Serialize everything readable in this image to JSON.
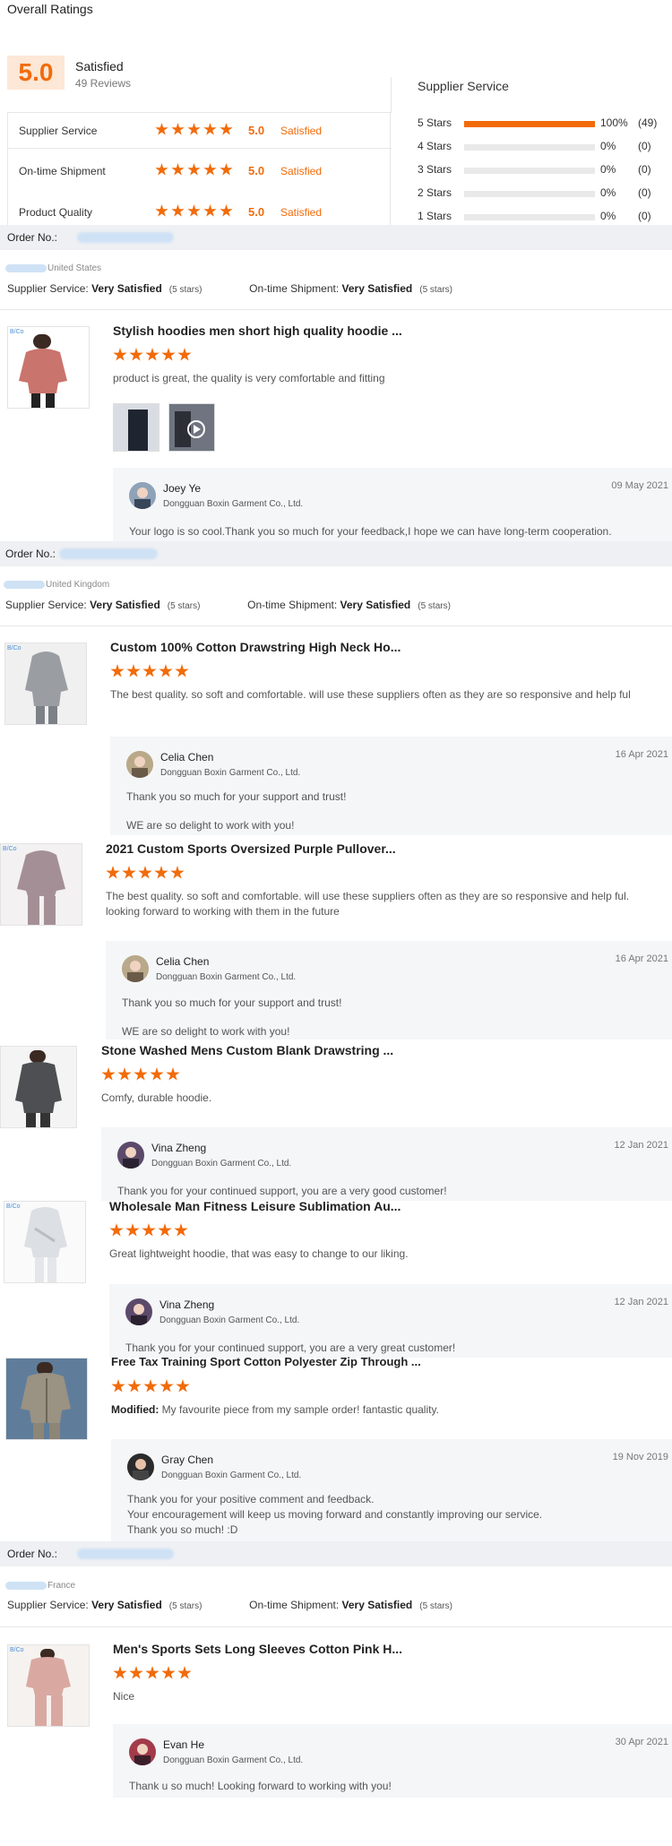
{
  "header": {
    "title": "Overall Ratings"
  },
  "overall": {
    "score": "5.0",
    "label": "Satisfied",
    "reviews": "49 Reviews"
  },
  "summary": [
    {
      "label": "Supplier Service",
      "score": "5.0",
      "word": "Satisfied"
    },
    {
      "label": "On-time Shipment",
      "score": "5.0",
      "word": "Satisfied"
    },
    {
      "label": "Product Quality",
      "score": "5.0",
      "word": "Satisfied"
    }
  ],
  "supplier_service": {
    "title": "Supplier Service",
    "rows": [
      {
        "label": "5 Stars",
        "fill": 1.0,
        "pct": "100%",
        "count": "(49)"
      },
      {
        "label": "4 Stars",
        "fill": 0,
        "pct": "0%",
        "count": "(0)"
      },
      {
        "label": "3 Stars",
        "fill": 0,
        "pct": "0%",
        "count": "(0)"
      },
      {
        "label": "2 Stars",
        "fill": 0,
        "pct": "0%",
        "count": "(0)"
      },
      {
        "label": "1 Stars",
        "fill": 0,
        "pct": "0%",
        "count": "(0)"
      }
    ]
  },
  "labels": {
    "order_no": "Order No.:",
    "supplier_service": "Supplier Service:",
    "ontime_shipment": "On-time Shipment:",
    "very_satisfied": "Very Satisfied",
    "five_stars": "(5 stars)",
    "company": "Dongguan Boxin Garment Co., Ltd.",
    "modified": "Modified:"
  },
  "orders": [
    {
      "country": "United States"
    },
    {
      "country": "United Kingdom"
    },
    {
      "country": "France"
    }
  ],
  "reviews": [
    {
      "product": "Stylish hoodies men short high quality hoodie ...",
      "text": "product is great, the quality is very comfortable and fitting",
      "reply_name": "Joey Ye",
      "reply_date": "09 May 2021",
      "reply": "Your logo is so cool.Thank you so much for your feedback,I hope we can have long-term cooperation."
    },
    {
      "product": "Custom 100% Cotton Drawstring High Neck Ho...",
      "text": "The best quality. so soft and comfortable. will use these suppliers often as they are so responsive and help ful",
      "reply_name": "Celia Chen",
      "reply_date": "16 Apr 2021",
      "reply_1": "Thank you so much for your support and trust!",
      "reply_2": "WE are so delight to work with you!"
    },
    {
      "product": "2021 Custom Sports Oversized Purple Pullover...",
      "text": "The best quality. so soft and comfortable. will use these suppliers often as they are so responsive and help ful. looking forward to working with them in the future",
      "reply_name": "Celia Chen",
      "reply_date": "16 Apr 2021",
      "reply_1": "Thank you so much for your support and trust!",
      "reply_2": "WE are so delight to work with you!"
    },
    {
      "product": "Stone Washed Mens Custom Blank Drawstring ...",
      "text": "Comfy, durable hoodie.",
      "reply_name": "Vina Zheng",
      "reply_date": "12 Jan 2021",
      "reply": "Thank you for your continued support, you are a very good customer!"
    },
    {
      "product": "Wholesale Man Fitness Leisure Sublimation Au...",
      "text": "Great lightweight hoodie, that was easy to change to our liking.",
      "reply_name": "Vina Zheng",
      "reply_date": "12 Jan 2021",
      "reply": "Thank you for your continued support, you are a very great customer!"
    },
    {
      "product": "Free Tax Training Sport Cotton Polyester Zip Through ...",
      "text": "My favourite piece from my sample order! fantastic quality.",
      "reply_name": "Gray Chen",
      "reply_date": "19 Nov 2019",
      "reply_1": "Thank you for your positive comment and feedback.",
      "reply_2": "Your encouragement will keep us moving forward and constantly improving our service.",
      "reply_3": "Thank you so much! :D"
    },
    {
      "product": "Men's Sports Sets Long Sleeves Cotton Pink H...",
      "text": "Nice",
      "reply_name": "Evan He",
      "reply_date": "30 Apr 2021",
      "reply": "Thank u so much! Looking forward to working with you!"
    }
  ],
  "colors": {
    "accent": "#f26b0a",
    "order_bg": "#eef0f3",
    "reply_bg": "#f5f6f8"
  }
}
